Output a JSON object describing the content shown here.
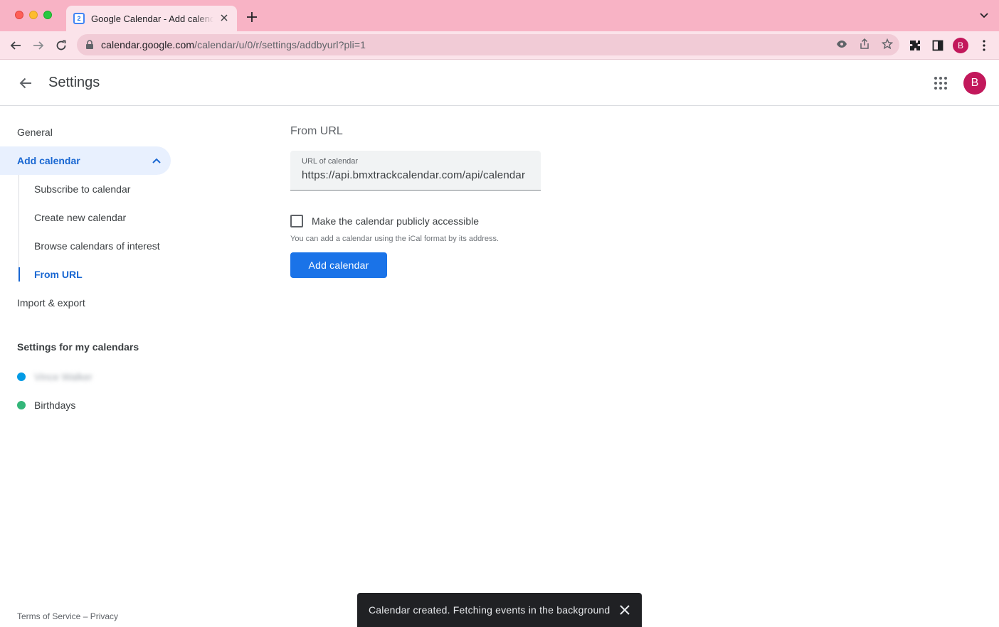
{
  "browser": {
    "tab_title": "Google Calendar - Add calendar",
    "favicon_text": "2",
    "url_host": "calendar.google.com",
    "url_path": "/calendar/u/0/r/settings/addbyurl?pli=1",
    "profile_initial": "B"
  },
  "header": {
    "title": "Settings",
    "avatar_initial": "B"
  },
  "sidebar": {
    "general": "General",
    "add_calendar": "Add calendar",
    "sub_items": [
      "Subscribe to calendar",
      "Create new calendar",
      "Browse calendars of interest",
      "From URL"
    ],
    "import_export": "Import & export",
    "my_calendars_title": "Settings for my calendars",
    "calendars": [
      {
        "name": "Vince Walker",
        "color": "#039be5"
      },
      {
        "name": "Birthdays",
        "color": "#33b679"
      }
    ],
    "footer": "Terms of Service – Privacy"
  },
  "main": {
    "heading": "From URL",
    "url_label": "URL of calendar",
    "url_value": "https://api.bmxtrackcalendar.com/api/calendar",
    "public_checkbox_label": "Make the calendar publicly accessible",
    "public_checked": false,
    "help_text": "You can add a calendar using the iCal format by its address.",
    "add_button": "Add calendar"
  },
  "snackbar": {
    "message": "Calendar created. Fetching events in the background"
  },
  "colors": {
    "accent": "#1a73e8",
    "active_text": "#1967d2",
    "titlebar": "#f8b3c5"
  }
}
